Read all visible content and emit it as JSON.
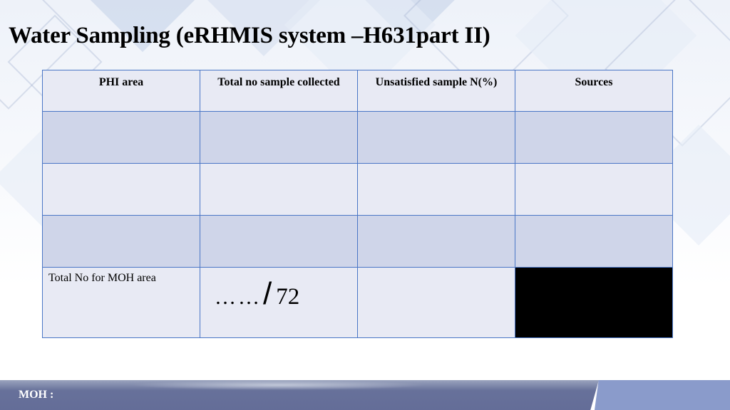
{
  "slide": {
    "title": "Water Sampling (eRHMIS system –H631part II)"
  },
  "table": {
    "headers": [
      "PHI area",
      "Total no sample collected",
      "Unsatisfied sample N(%)",
      "Sources"
    ],
    "rows": [
      [
        "",
        "",
        "",
        ""
      ],
      [
        "",
        "",
        "",
        ""
      ],
      [
        "",
        "",
        "",
        ""
      ]
    ],
    "total_row": {
      "label": "Total  No for MOH area",
      "collected_blank": "……",
      "collected_separator": "/",
      "collected_target": "72",
      "unsatisfied": "",
      "sources": ""
    },
    "colors": {
      "border": "#4a76c6",
      "header_bg": "#e8eaf4",
      "band_bg": "#cfd5e9",
      "blackout": "#000000"
    }
  },
  "footer": {
    "label": "MOH :",
    "colors": {
      "dark": "#646d98",
      "light": "#8a9bcb"
    }
  }
}
